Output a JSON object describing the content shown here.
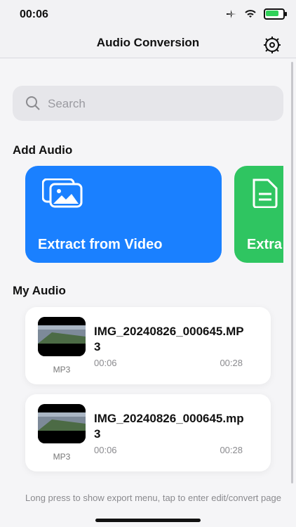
{
  "status": {
    "time": "00:06"
  },
  "nav": {
    "title": "Audio Conversion"
  },
  "search": {
    "placeholder": "Search"
  },
  "sections": {
    "add_audio": "Add Audio",
    "my_audio": "My Audio"
  },
  "cards": [
    {
      "label": "Extract from Video",
      "icon": "image-gallery-icon"
    },
    {
      "label": "Extra",
      "icon": "document-icon"
    }
  ],
  "audio_items": [
    {
      "title": "IMG_20240826_000645.MP3",
      "badge": "MP3",
      "time_start": "00:06",
      "time_end": "00:28"
    },
    {
      "title": "IMG_20240826_000645.mp3",
      "badge": "MP3",
      "time_start": "00:06",
      "time_end": "00:28"
    }
  ],
  "hint": "Long press to show export menu, tap to enter edit/convert page",
  "colors": {
    "blue_card": "#1a80ff",
    "green_card": "#2fc561"
  }
}
